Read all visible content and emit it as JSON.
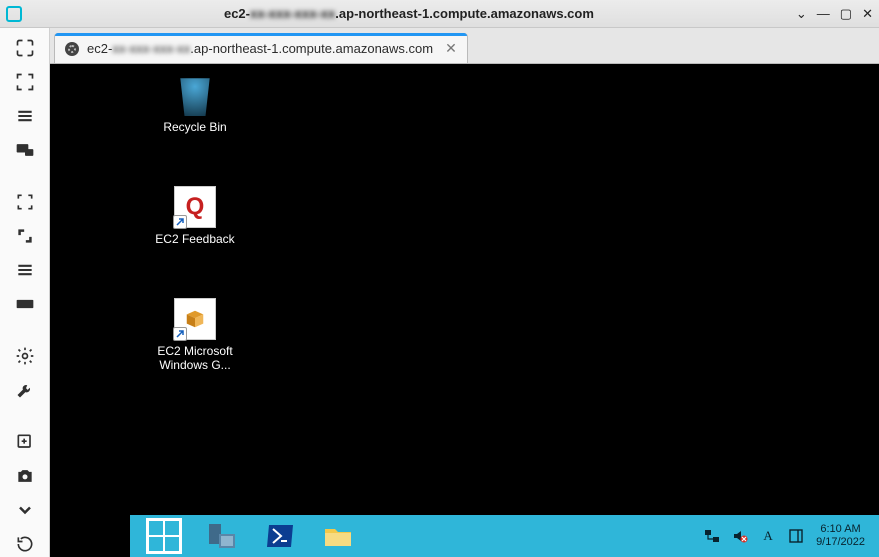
{
  "window": {
    "title_prefix": "ec2-",
    "title_blur": "xx-xxx-xxx-xx",
    "title_suffix": ".ap-northeast-1.compute.amazonaws.com"
  },
  "tab": {
    "label_prefix": "ec2-",
    "label_blur": "xx-xxx-xxx-xx",
    "label_suffix": ".ap-northeast-1.compute.amazonaws.com"
  },
  "desktop": {
    "icons": [
      {
        "id": "recycle-bin",
        "label": "Recycle Bin"
      },
      {
        "id": "ec2-feedback",
        "label": "EC2 Feedback",
        "glyph": "Q"
      },
      {
        "id": "ec2-windows-guide",
        "label": "EC2 Microsoft Windows G..."
      }
    ]
  },
  "taskbar": {
    "ime": "A",
    "time": "6:10 AM",
    "date": "9/17/2022"
  }
}
